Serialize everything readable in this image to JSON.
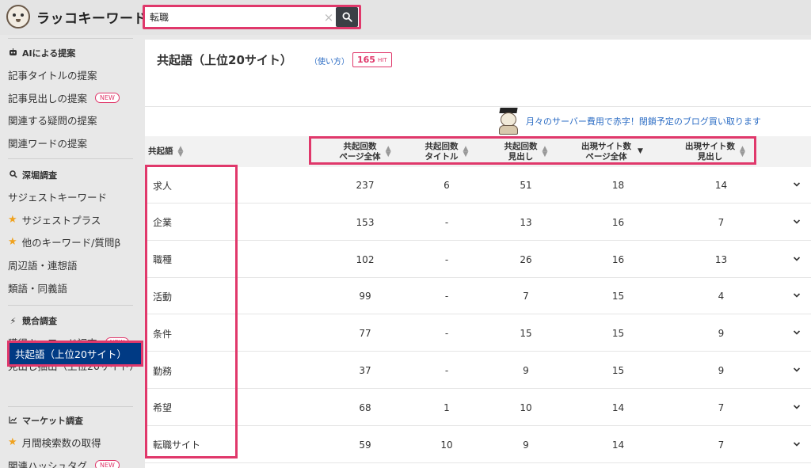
{
  "brand": {
    "name": "ラッコキーワード"
  },
  "search": {
    "value": "転職",
    "clear_glyph": "×"
  },
  "sidebar": {
    "sections": [
      {
        "icon": "robot-icon",
        "label": "AIによる提案"
      },
      {
        "icon": "search-icon",
        "label": "深堀調査"
      },
      {
        "icon": "bolt-icon",
        "label": "競合調査"
      },
      {
        "icon": "chart-icon",
        "label": "マーケット調査"
      }
    ],
    "items": [
      {
        "label": "記事タイトルの提案"
      },
      {
        "label": "記事見出しの提案"
      },
      {
        "label": "関連する疑問の提案"
      },
      {
        "label": "関連ワードの提案"
      },
      {
        "label": "サジェストキーワード"
      },
      {
        "label": "サジェストプラス"
      },
      {
        "label": "他のキーワード/質問β"
      },
      {
        "label": "周辺語・連想語"
      },
      {
        "label": "類語・同義語"
      },
      {
        "label": "獲得キーワード調査"
      },
      {
        "label": "見出し抽出（上位20サイト）"
      },
      {
        "label": "共起語（上位20サイト）"
      },
      {
        "label": "月間検索数の取得"
      },
      {
        "label": "関連ハッシュタグ"
      }
    ],
    "new_badge": "NEW"
  },
  "main": {
    "title": "共起語（上位20サイト）",
    "howto": "（使い方）",
    "hit_count": "165",
    "hit_unit": "HIT",
    "promo": "月々のサーバー費用で赤字！閉鎖予定のブログ買い取ります"
  },
  "table": {
    "headers": {
      "word": "共起語",
      "page_count_l1": "共起回数",
      "page_count_l2": "ページ全体",
      "title_count_l1": "共起回数",
      "title_count_l2": "タイトル",
      "heading_count_l1": "共起回数",
      "heading_count_l2": "見出し",
      "site_page_l1": "出現サイト数",
      "site_page_l2": "ページ全体",
      "site_heading_l1": "出現サイト数",
      "site_heading_l2": "見出し"
    },
    "rows": [
      {
        "word": "求人",
        "page": "237",
        "title": "6",
        "heading": "51",
        "site_page": "18",
        "site_heading": "14"
      },
      {
        "word": "企業",
        "page": "153",
        "title": "-",
        "heading": "13",
        "site_page": "16",
        "site_heading": "7"
      },
      {
        "word": "職種",
        "page": "102",
        "title": "-",
        "heading": "26",
        "site_page": "16",
        "site_heading": "13"
      },
      {
        "word": "活動",
        "page": "99",
        "title": "-",
        "heading": "7",
        "site_page": "15",
        "site_heading": "4"
      },
      {
        "word": "条件",
        "page": "77",
        "title": "-",
        "heading": "15",
        "site_page": "15",
        "site_heading": "9"
      },
      {
        "word": "勤務",
        "page": "37",
        "title": "-",
        "heading": "9",
        "site_page": "15",
        "site_heading": "9"
      },
      {
        "word": "希望",
        "page": "68",
        "title": "1",
        "heading": "10",
        "site_page": "14",
        "site_heading": "7"
      },
      {
        "word": "転職サイト",
        "page": "59",
        "title": "10",
        "heading": "9",
        "site_page": "14",
        "site_heading": "7"
      }
    ]
  },
  "colors": {
    "accent": "#e0386b",
    "active_nav": "#003a84",
    "link": "#2b6cc4",
    "star": "#f0a21e"
  }
}
